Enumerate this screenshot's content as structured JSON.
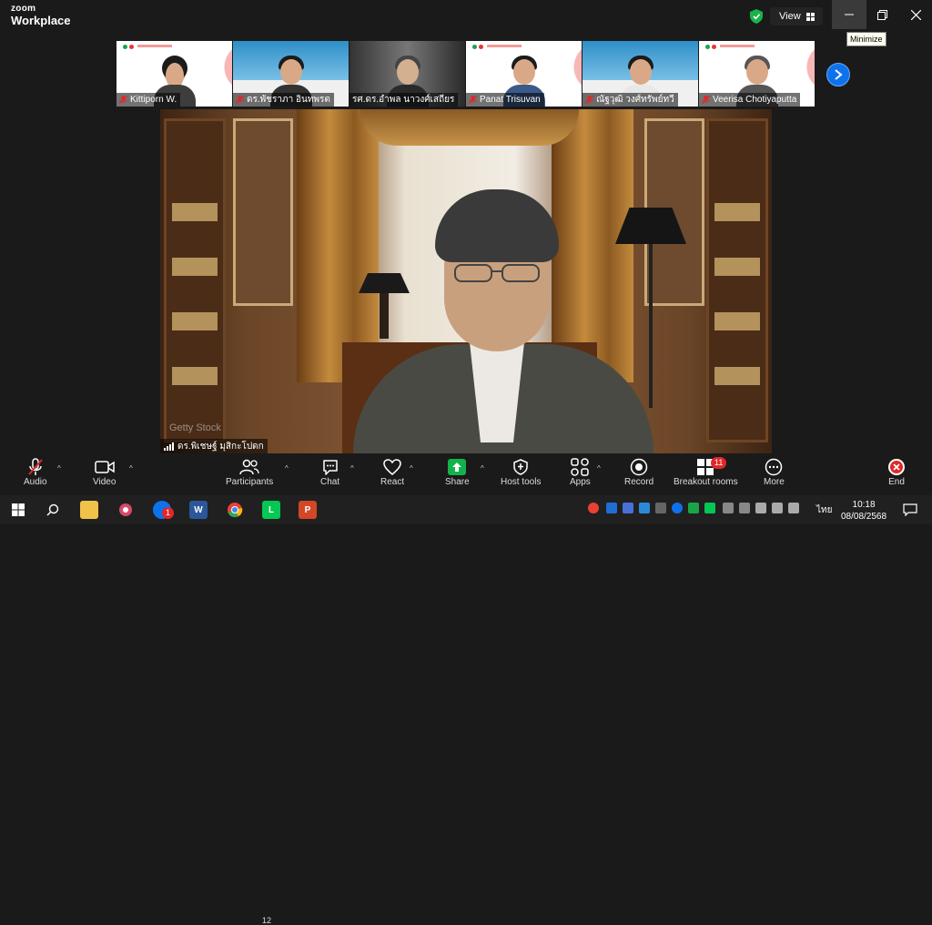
{
  "app": {
    "logo_line1": "zoom",
    "logo_line2": "Workplace"
  },
  "titlebar": {
    "view_label": "View",
    "tooltip": "Minimize"
  },
  "thumbnails": [
    {
      "name": "Kittiporn W."
    },
    {
      "name": "ดร.พัชราภา อินทพรต"
    },
    {
      "name": "รศ.ดร.อำพล นาวงศ์เสถียร"
    },
    {
      "name": "Panat Trisuvan"
    },
    {
      "name": "ณัฐวุฒิ วงศ์ทรัพย์ทวี"
    },
    {
      "name": "Veerisa Chotiyaputta"
    }
  ],
  "main_video": {
    "speaker_name": "ดร.พิเชษฐ์ มุสิกะโปดก",
    "watermark": "Getty Stock"
  },
  "toolbar": {
    "audio": "Audio",
    "video": "Video",
    "participants": "Participants",
    "participants_count": "12",
    "chat": "Chat",
    "react": "React",
    "share": "Share",
    "host_tools": "Host tools",
    "apps": "Apps",
    "record": "Record",
    "breakout": "Breakout rooms",
    "breakout_badge": "11",
    "more": "More",
    "end": "End"
  },
  "taskbar": {
    "time": "10:18",
    "date": "08/08/2568",
    "lang": "ไทย",
    "zoom_badge": "1"
  },
  "colors": {
    "accent": "#0e72ed",
    "share_green": "#12b34c",
    "end_red": "#e02828",
    "shield_green": "#19b34a"
  },
  "icons": [
    "windows-icon",
    "search-icon",
    "file-explorer-icon",
    "pinned-app-icon",
    "zoom-icon",
    "word-icon",
    "chrome-icon",
    "line-icon",
    "powerpoint-icon"
  ]
}
